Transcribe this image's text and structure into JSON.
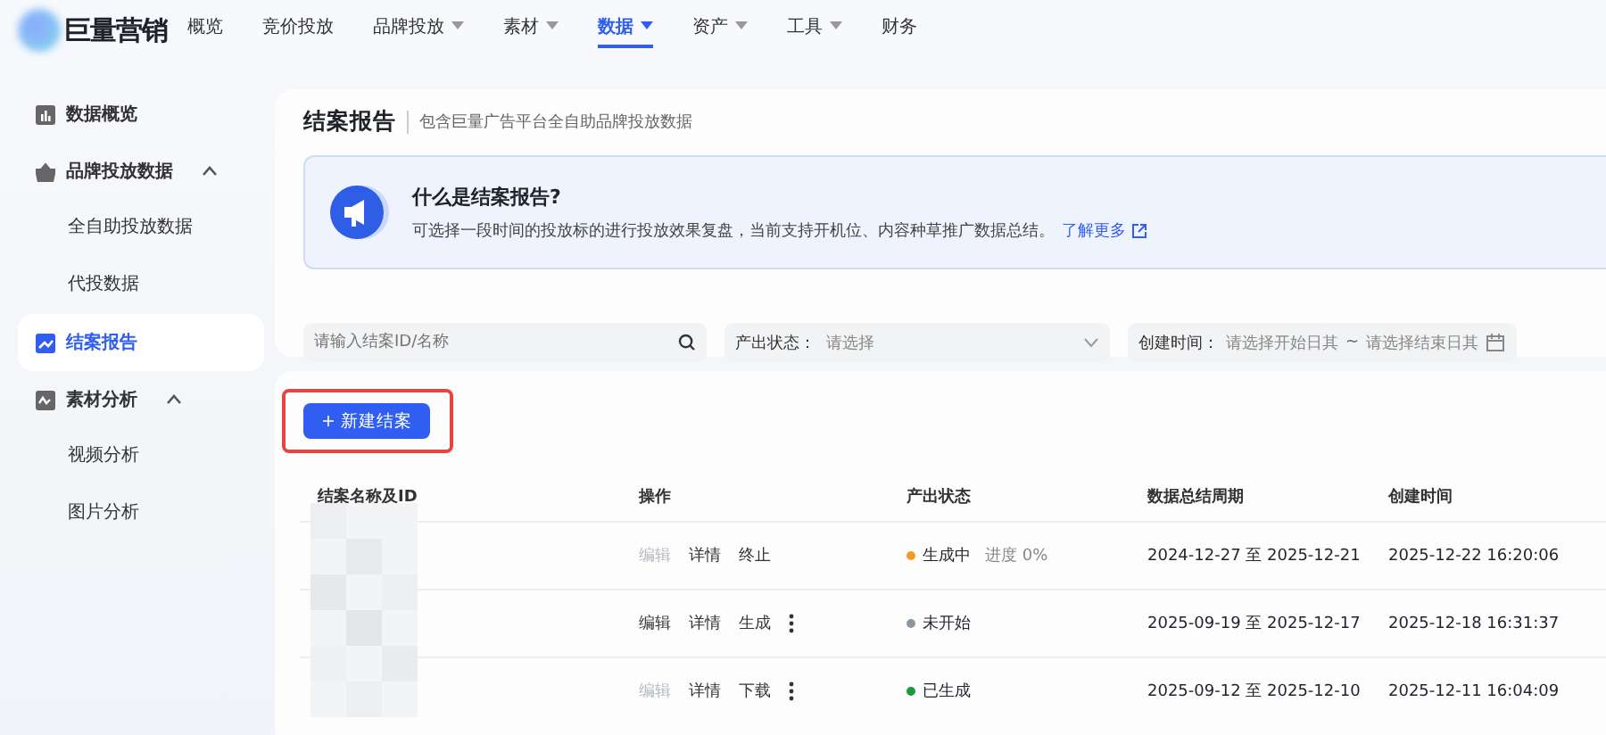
{
  "brand": "巨量营销",
  "nav": [
    {
      "label": "概览",
      "dropdown": false,
      "selected": false
    },
    {
      "label": "竞价投放",
      "dropdown": false,
      "selected": false
    },
    {
      "label": "品牌投放",
      "dropdown": true,
      "selected": false
    },
    {
      "label": "素材",
      "dropdown": true,
      "selected": false
    },
    {
      "label": "数据",
      "dropdown": true,
      "selected": true
    },
    {
      "label": "资产",
      "dropdown": true,
      "selected": false
    },
    {
      "label": "工具",
      "dropdown": true,
      "selected": false
    },
    {
      "label": "财务",
      "dropdown": false,
      "selected": false
    }
  ],
  "sidebar": {
    "items": [
      {
        "label": "数据概览",
        "kind": "overview",
        "selected": false
      },
      {
        "label": "品牌投放数据",
        "kind": "brand",
        "selected": false,
        "expanded": true,
        "children": [
          {
            "label": "全自助投放数据",
            "selected": false
          },
          {
            "label": "代投数据",
            "selected": false
          }
        ]
      },
      {
        "label": "结案报告",
        "kind": "report",
        "selected": true
      },
      {
        "label": "素材分析",
        "kind": "material",
        "selected": false,
        "expanded": true,
        "children": [
          {
            "label": "视频分析",
            "selected": false
          },
          {
            "label": "图片分析",
            "selected": false
          }
        ]
      }
    ]
  },
  "page": {
    "title": "结案报告",
    "subtitle": "包含巨量广告平台全自助品牌投放数据"
  },
  "info": {
    "title": "什么是结案报告?",
    "text": "可选择一段时间的投放标的进行投放效果复盘，当前支持开机位、内容种草推广数据总结。",
    "link": "了解更多"
  },
  "filters": {
    "search": {
      "placeholder": "请输入结案ID/名称"
    },
    "status": {
      "label": "产出状态：",
      "placeholder": "请选择"
    },
    "date": {
      "label": "创建时间：",
      "start_placeholder": "请选择开始日其",
      "separator": "~",
      "end_placeholder": "请选择结束日其"
    }
  },
  "new_button": "+ 新建结案",
  "table": {
    "columns": [
      "结案名称及ID",
      "操作",
      "产出状态",
      "数据总结周期",
      "创建时间"
    ],
    "rows": [
      {
        "actions": [
          {
            "label": "编辑",
            "disabled": true
          },
          {
            "label": "详情",
            "disabled": false
          },
          {
            "label": "终止",
            "disabled": false
          }
        ],
        "more": false,
        "status": "生成中",
        "color": "#f59a23",
        "progress": "进度 0%",
        "period": "2024-12-27 至 2025-12-21",
        "created": "2025-12-22 16:20:06"
      },
      {
        "actions": [
          {
            "label": "编辑",
            "disabled": false
          },
          {
            "label": "详情",
            "disabled": false
          },
          {
            "label": "生成",
            "disabled": false
          }
        ],
        "more": true,
        "status": "未开始",
        "color": "#8f959e",
        "period": "2025-09-19 至 2025-12-17",
        "created": "2025-12-18 16:31:37"
      },
      {
        "actions": [
          {
            "label": "编辑",
            "disabled": true
          },
          {
            "label": "详情",
            "disabled": false
          },
          {
            "label": "下载",
            "disabled": false
          }
        ],
        "more": true,
        "status": "已生成",
        "color": "#1a9b3c",
        "period": "2025-09-12 至 2025-12-10",
        "created": "2025-12-11 16:04:09"
      }
    ]
  }
}
